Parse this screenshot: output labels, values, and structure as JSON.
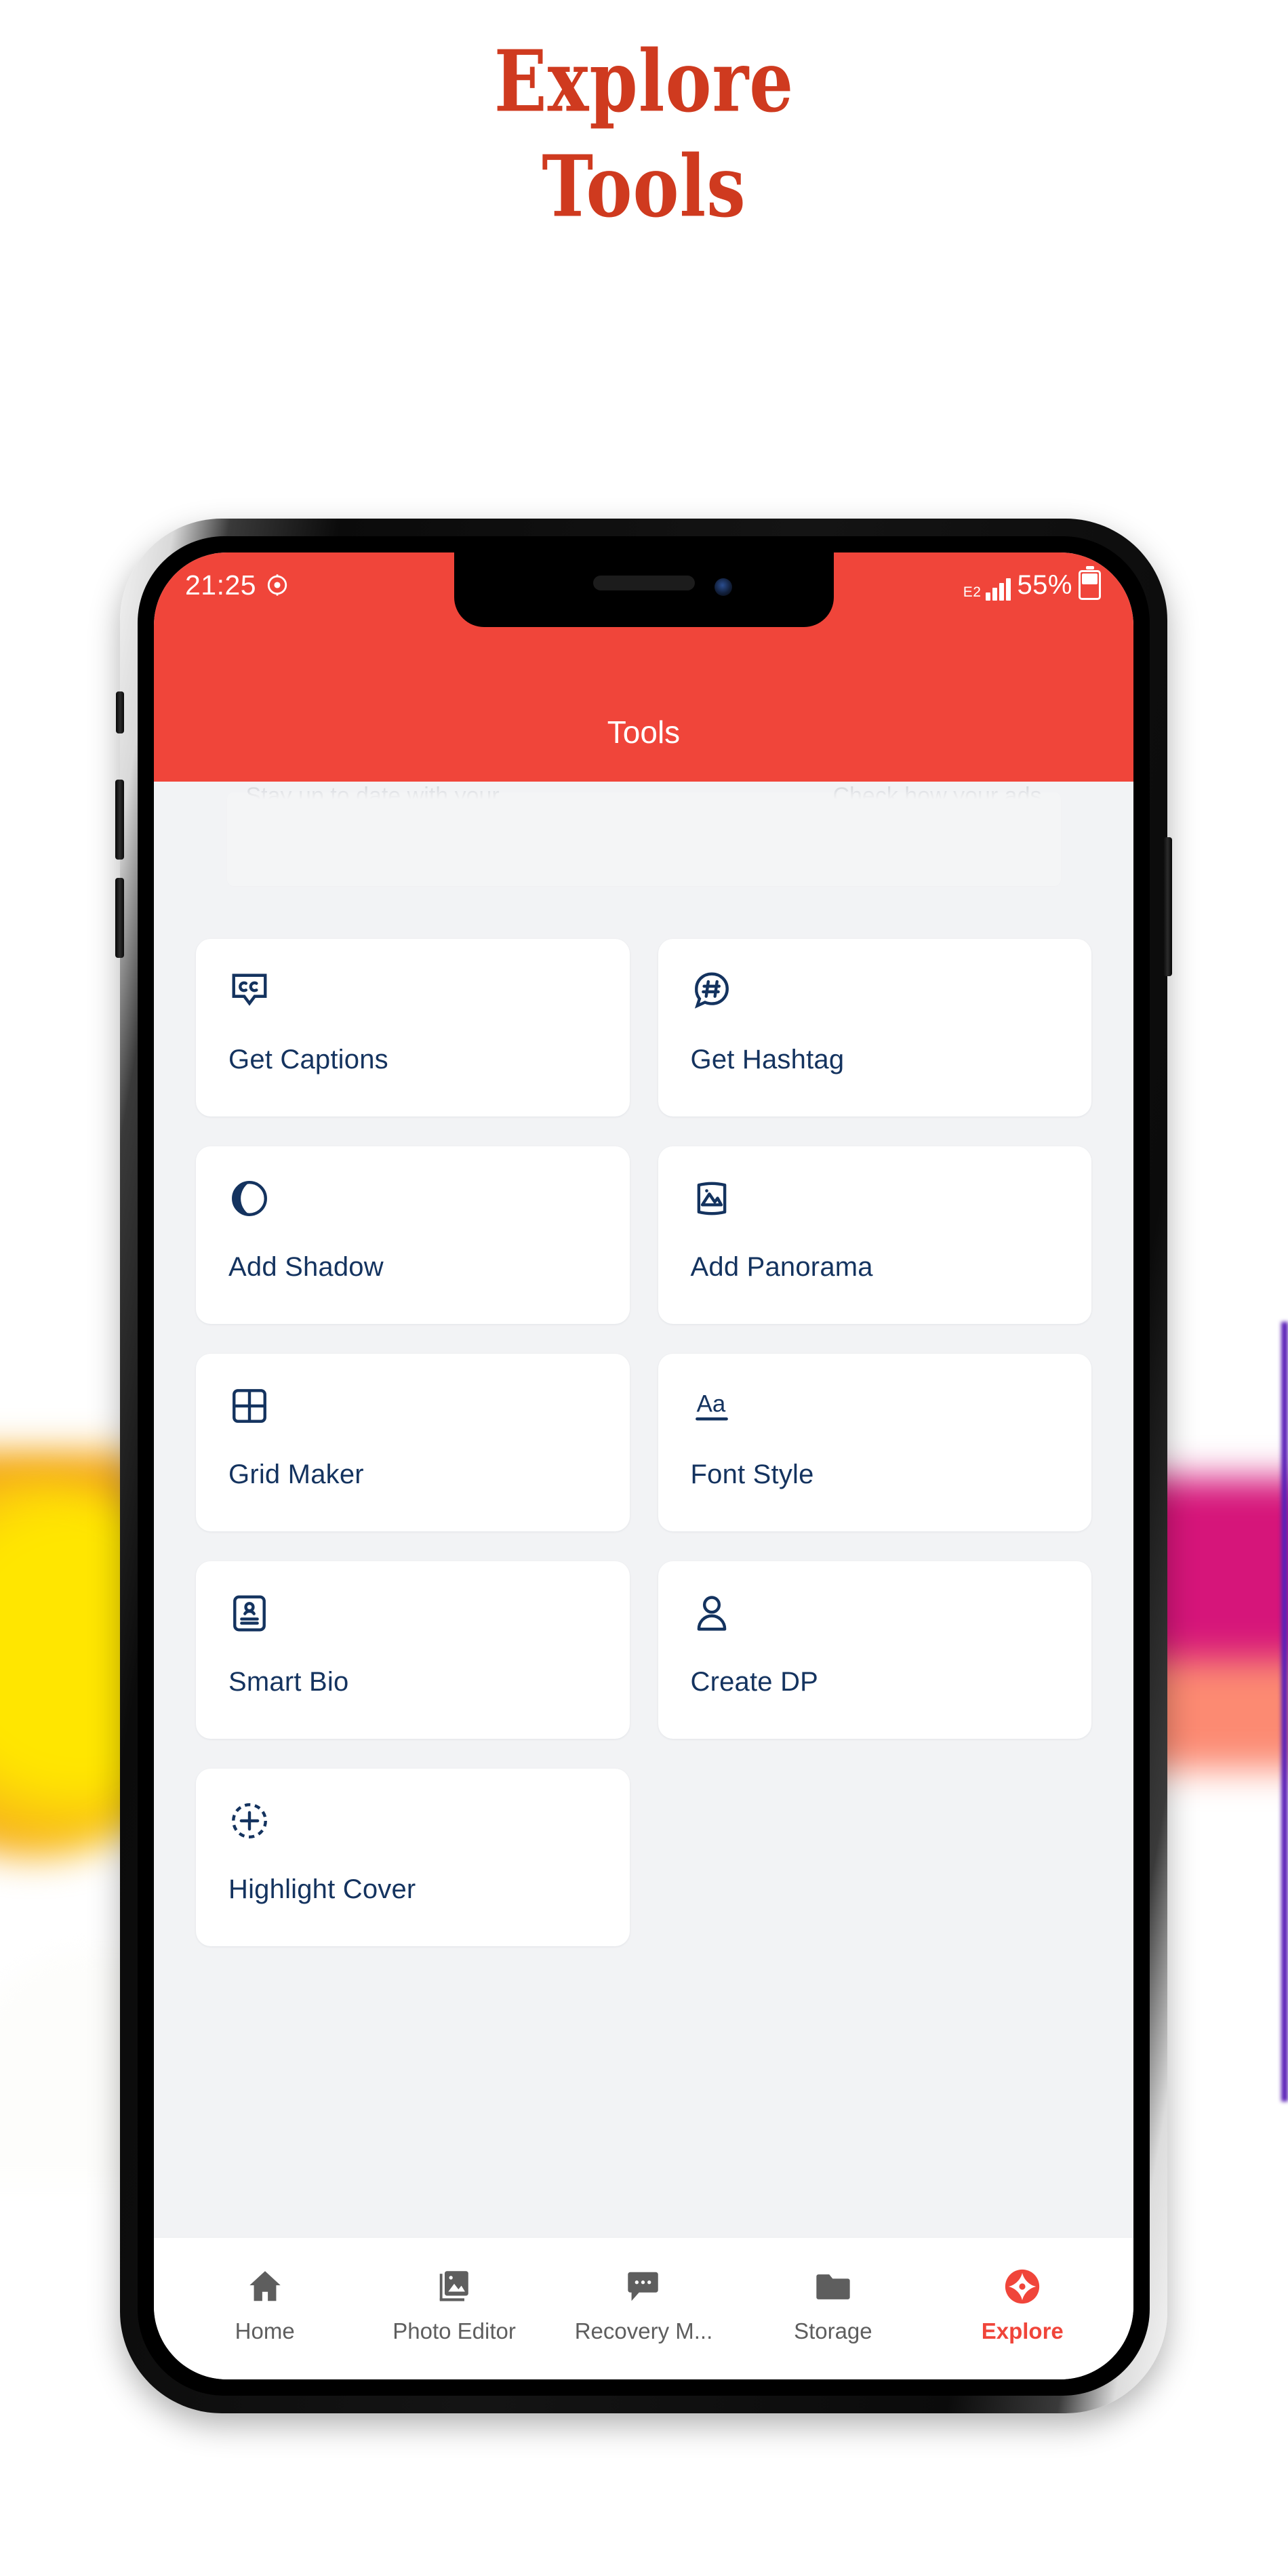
{
  "headline": {
    "line1": "Explore",
    "line2": "Tools"
  },
  "theme": {
    "accent_red": "#F0453A",
    "headline_red": "#CF3A1F",
    "icon_navy": "#14335F",
    "screen_bg": "#F2F3F5",
    "nav_grey": "#5E5E5E"
  },
  "status_bar": {
    "time": "21:25",
    "alarm_icon": "alarm-icon",
    "network_label": "E2",
    "battery_percent": "55%"
  },
  "app_bar": {
    "title": "Tools"
  },
  "promo": {
    "left_text": "Stay up to date with your",
    "right_text": "Check how your ads"
  },
  "tools": [
    {
      "label": "Get Captions",
      "icon": "closed-caption-icon"
    },
    {
      "label": "Get Hashtag",
      "icon": "hashtag-bubble-icon"
    },
    {
      "label": "Add Shadow",
      "icon": "shadow-circle-icon"
    },
    {
      "label": "Add Panorama",
      "icon": "panorama-icon"
    },
    {
      "label": "Grid Maker",
      "icon": "grid-icon"
    },
    {
      "label": "Font Style",
      "icon": "font-style-icon"
    },
    {
      "label": "Smart Bio",
      "icon": "id-card-icon"
    },
    {
      "label": "Create DP",
      "icon": "person-icon"
    },
    {
      "label": "Highlight Cover",
      "icon": "plus-circle-dashed-icon"
    }
  ],
  "bottom_nav": [
    {
      "label": "Home",
      "icon": "home-icon",
      "active": false
    },
    {
      "label": "Photo Editor",
      "icon": "photo-editor-icon",
      "active": false
    },
    {
      "label": "Recovery M...",
      "icon": "chat-bubble-icon",
      "active": false
    },
    {
      "label": "Storage",
      "icon": "folder-icon",
      "active": false
    },
    {
      "label": "Explore",
      "icon": "explore-compass-icon",
      "active": true
    }
  ]
}
